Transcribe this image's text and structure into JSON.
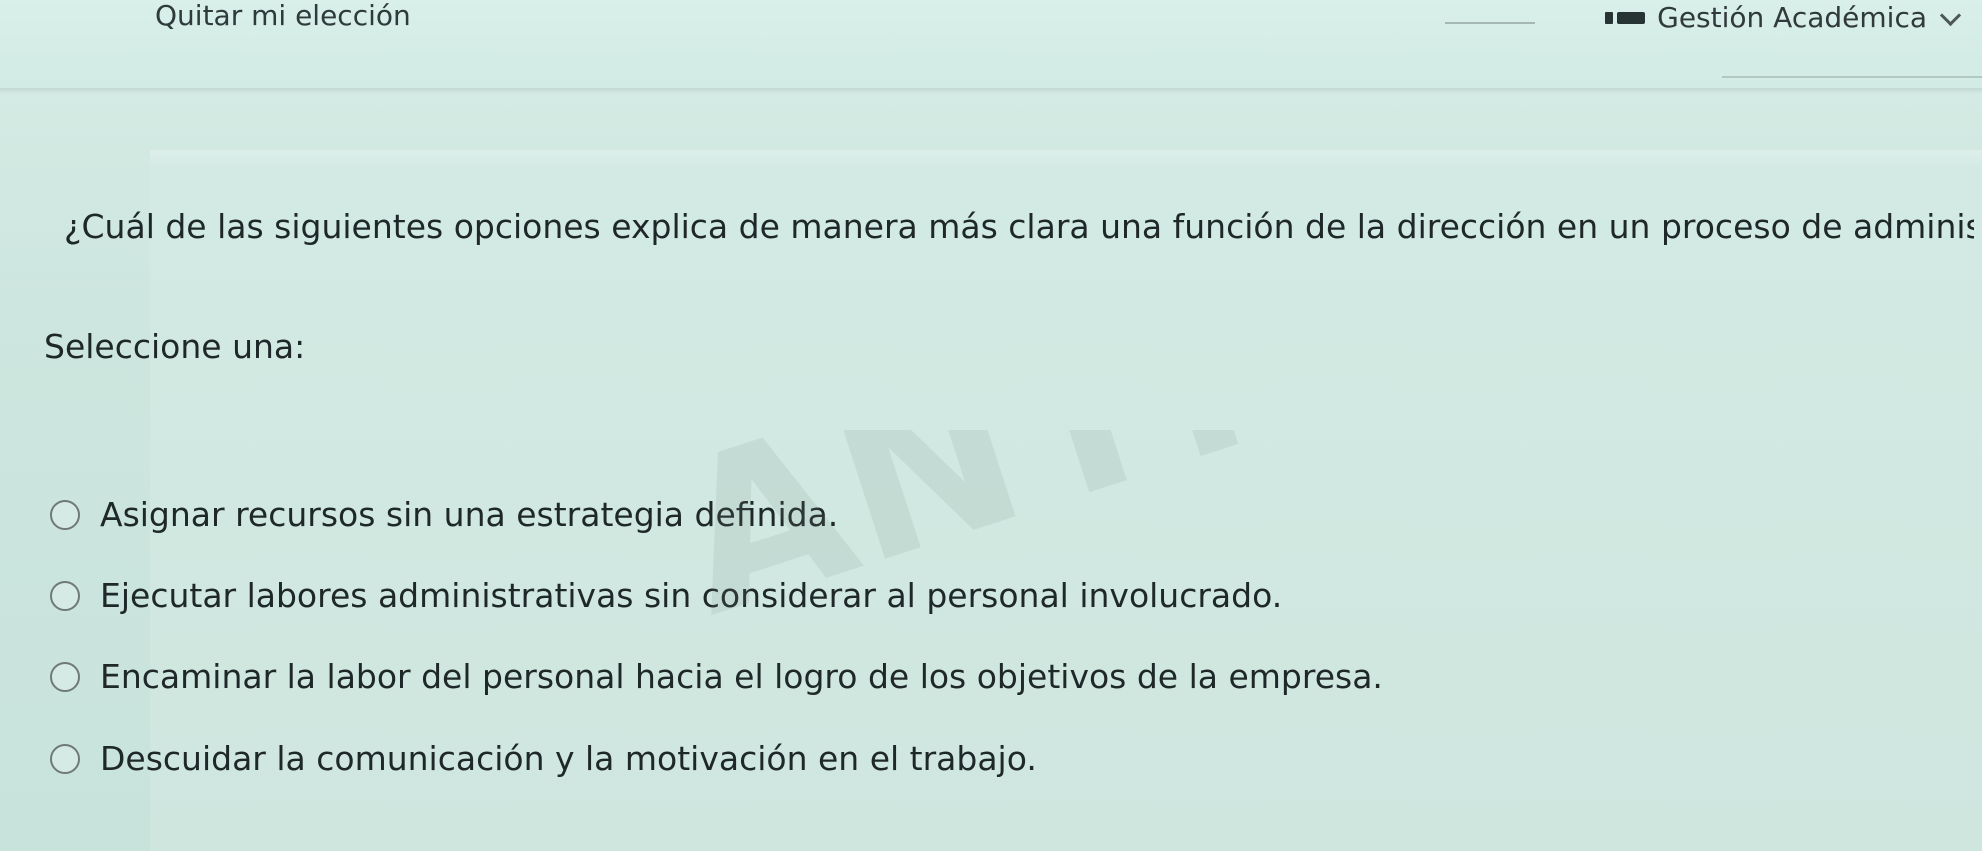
{
  "header": {
    "clear_choice_label": "Quitar mi elección",
    "academic_management_label": "Gestión Académica"
  },
  "question": {
    "text": "¿Cuál de las siguientes opciones explica de manera más clara una función de la dirección en un proceso de administrativo?",
    "select_label": "Seleccione una:",
    "options": [
      {
        "label": "Asignar recursos sin una estrategia definida."
      },
      {
        "label": "Ejecutar labores administrativas sin considerar al personal involucrado."
      },
      {
        "label": "Encaminar la labor del personal hacia el logro de los objetivos de la empresa."
      },
      {
        "label": "Descuidar la comunicación y la motivación en el trabajo."
      }
    ]
  },
  "watermark": {
    "text": "ANYI YULIETH MUNO"
  },
  "colors": {
    "background": "#cfe7e0",
    "text": "#1f2828",
    "muted_text": "#303a3a",
    "radio_border": "#6f7979"
  },
  "icons": {
    "academic_management": "graduation-cap-icon",
    "chevron": "chevron-down-icon"
  }
}
